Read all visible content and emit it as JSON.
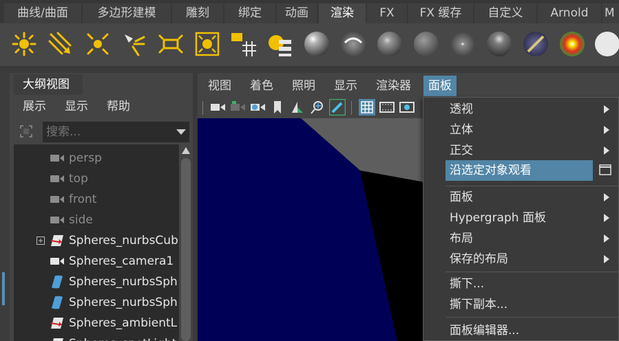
{
  "shelf_tabs": [
    {
      "label": "曲线/曲面",
      "active": false
    },
    {
      "label": "多边形建模",
      "active": false
    },
    {
      "label": "雕刻",
      "active": false
    },
    {
      "label": "绑定",
      "active": false
    },
    {
      "label": "动画",
      "active": false
    },
    {
      "label": "渲染",
      "active": true
    },
    {
      "label": "FX",
      "active": false
    },
    {
      "label": "FX 缓存",
      "active": false
    },
    {
      "label": "自定义",
      "active": false
    },
    {
      "label": "Arnold",
      "active": false
    },
    {
      "label": "M",
      "active": false
    }
  ],
  "shelf_icons": [
    "point-light-icon",
    "directional-light-icon",
    "ambient-light-icon",
    "spot-light-icon",
    "area-light-icon",
    "volume-light-icon",
    "light-link-icon",
    "light-editor-icon",
    "blinn-sphere-icon",
    "anisotropic-sphere-icon",
    "phong-sphere-icon",
    "lambert-sphere-icon",
    "phong-e-sphere-icon",
    "layered-shader-icon",
    "ramp-shader-icon",
    "surface-shader-icon",
    "render-sphere-icon"
  ],
  "outliner": {
    "tab_label": "大纲视图",
    "menu": [
      "展示",
      "显示",
      "帮助"
    ],
    "search_placeholder": "搜索...",
    "items": [
      {
        "label": "persp",
        "icon": "camera-icon",
        "dim": true,
        "expandable": false
      },
      {
        "label": "top",
        "icon": "camera-icon",
        "dim": true,
        "expandable": false
      },
      {
        "label": "front",
        "icon": "camera-icon",
        "dim": true,
        "expandable": false
      },
      {
        "label": "side",
        "icon": "camera-icon",
        "dim": true,
        "expandable": false
      },
      {
        "label": "Spheres_nurbsCub",
        "icon": "transform-icon",
        "dim": false,
        "expandable": true
      },
      {
        "label": "Spheres_camera1",
        "icon": "camera-icon",
        "dim": false,
        "expandable": false
      },
      {
        "label": "Spheres_nurbsSph",
        "icon": "nurbs-surface-icon",
        "dim": false,
        "expandable": false
      },
      {
        "label": "Spheres_nurbsSph",
        "icon": "nurbs-surface-icon",
        "dim": false,
        "expandable": false
      },
      {
        "label": "Spheres_ambientL",
        "icon": "transform-icon",
        "dim": false,
        "expandable": false
      },
      {
        "label": "Spheres_spotLight",
        "icon": "transform-icon",
        "dim": false,
        "expandable": false
      }
    ]
  },
  "panel_menu": [
    {
      "label": "视图",
      "active": false
    },
    {
      "label": "着色",
      "active": false
    },
    {
      "label": "照明",
      "active": false
    },
    {
      "label": "显示",
      "active": false
    },
    {
      "label": "渲染器",
      "active": false
    },
    {
      "label": "面板",
      "active": true
    }
  ],
  "panel_toolbar_icons": [
    "select-camera-icon",
    "camera-attributes-icon",
    "camera-settings-icon",
    "bookmark-icon",
    "image-plane-icon",
    "two-d-pan-zoom-icon",
    "grease-pencil-icon",
    "grid-icon",
    "film-gate-icon",
    "resolution-gate-icon"
  ],
  "panel_dropdown": {
    "items": [
      {
        "label": "透视",
        "submenu": true,
        "highlight": false,
        "option_box": false
      },
      {
        "label": "立体",
        "submenu": true,
        "highlight": false,
        "option_box": false
      },
      {
        "label": "正交",
        "submenu": true,
        "highlight": false,
        "option_box": false
      },
      {
        "label": "沿选定对象观看",
        "submenu": false,
        "highlight": true,
        "option_box": true
      },
      {
        "label": "面板",
        "submenu": true,
        "highlight": false,
        "option_box": false
      },
      {
        "label": "Hypergraph 面板",
        "submenu": true,
        "highlight": false,
        "option_box": false
      },
      {
        "label": "布局",
        "submenu": true,
        "highlight": false,
        "option_box": false
      },
      {
        "label": "保存的布局",
        "submenu": true,
        "highlight": false,
        "option_box": false
      },
      {
        "label": "撕下...",
        "submenu": false,
        "highlight": false,
        "option_box": false
      },
      {
        "label": "撕下副本...",
        "submenu": false,
        "highlight": false,
        "option_box": false
      },
      {
        "label": "面板编辑器...",
        "submenu": false,
        "highlight": false,
        "option_box": false
      }
    ]
  },
  "colors": {
    "accent": "#5285a6",
    "view_dark_blue": "#000057",
    "view_grey": "#5e5e5e",
    "light_icon_yellow": "#f0c000"
  }
}
